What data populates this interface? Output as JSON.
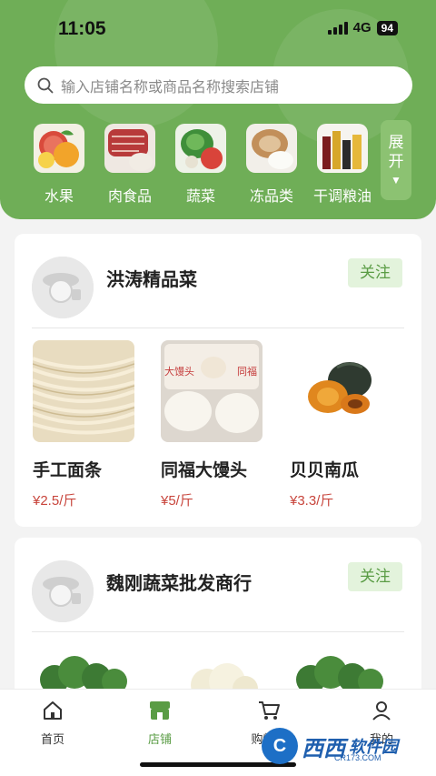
{
  "status_bar": {
    "time": "11:05",
    "network": "4G",
    "battery": "94"
  },
  "search": {
    "placeholder": "输入店铺名称或商品名称搜索店铺"
  },
  "categories": [
    {
      "label": "水果",
      "icon": "fruit-image"
    },
    {
      "label": "肉食品",
      "icon": "meat-image"
    },
    {
      "label": "蔬菜",
      "icon": "vegetable-image"
    },
    {
      "label": "冻品类",
      "icon": "frozen-food-image"
    },
    {
      "label": "干调粮油",
      "icon": "grain-oil-image"
    }
  ],
  "expand": {
    "label_line1": "展",
    "label_line2": "开",
    "arrow": "▼"
  },
  "stores": [
    {
      "name": "洪涛精品菜",
      "follow_label": "关注",
      "products": [
        {
          "name": "手工面条",
          "price": "¥2.5/斤"
        },
        {
          "name": "同福大馒头",
          "price": "¥5/斤"
        },
        {
          "name": "贝贝南瓜",
          "price": "¥3.3/斤"
        }
      ]
    },
    {
      "name": "魏刚蔬菜批发商行",
      "follow_label": "关注",
      "products": []
    }
  ],
  "tabbar": [
    {
      "label": "首页",
      "icon": "home-icon"
    },
    {
      "label": "店铺",
      "icon": "store-icon",
      "active": true
    },
    {
      "label": "购物车",
      "icon": "cart-icon"
    },
    {
      "label": "我的",
      "icon": "profile-icon"
    }
  ],
  "watermark": {
    "brand": "西西",
    "suffix": "软件园",
    "domain": "CR173.COM"
  },
  "colors": {
    "accent": "#6fae57",
    "price": "#c8453c",
    "follow_bg": "#e3f3dc"
  }
}
